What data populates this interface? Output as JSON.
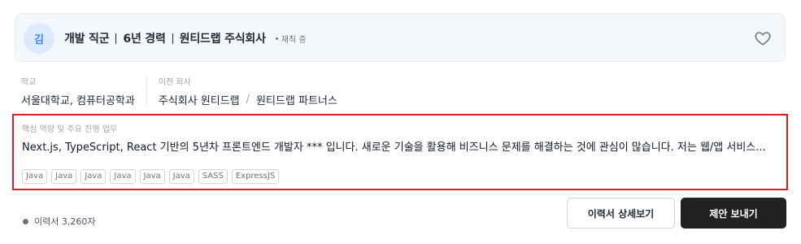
{
  "header": {
    "avatar_initial": "김",
    "items": [
      "개발 직군",
      "6년 경력",
      "원티드랩 주식회사"
    ],
    "status": "재직 중"
  },
  "info": {
    "school": {
      "label": "학교",
      "value": "서울대학교, 컴퓨터공학과"
    },
    "previous": {
      "label": "이전 회사",
      "companies": [
        "주식회사 원티드랩",
        "원티드랩 파트너스"
      ],
      "separator": "/"
    }
  },
  "skills": {
    "label": "핵심 역량 및 주요 진행 업무",
    "description": "Next.js, TypeScript, React 기반의 5년차 프론트엔드 개발자 *** 입니다. 새로운 기술을 활용해 비즈니스 문제를 해결하는 것에 관심이 많습니다. 저는 웹/앱 서비스...",
    "tags": [
      "Java",
      "Java",
      "Java",
      "Java",
      "Java",
      "Java",
      "SASS",
      "ExpressJS"
    ]
  },
  "footer": {
    "resume_length": "이력서 3,260자",
    "detail_button": "이력서 상세보기",
    "offer_button": "제안 보내기"
  },
  "icons": {
    "heart": "heart-outline-icon",
    "avatar_color": "#3b82f6",
    "highlight_color": "#e11d2a"
  }
}
